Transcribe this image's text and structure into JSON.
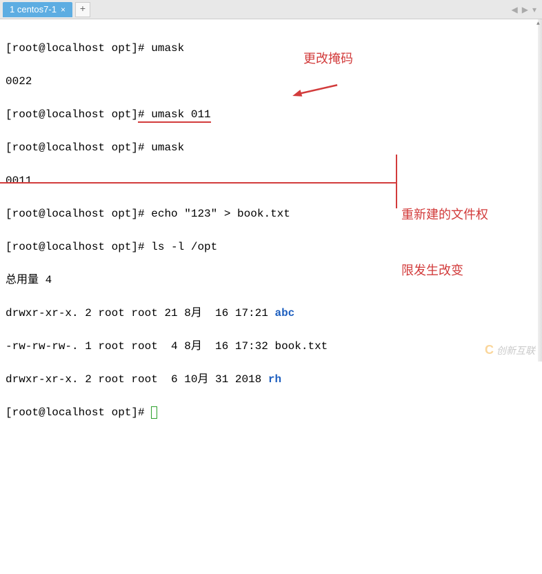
{
  "tab": {
    "label": "1 centos7-1",
    "close": "×"
  },
  "nav": {
    "left": "◀",
    "right": "▶",
    "menu": "▾"
  },
  "terminal": {
    "lines": [
      {
        "prompt": "[root@localhost opt]# ",
        "cmd": "umask"
      },
      {
        "text": "0022"
      },
      {
        "prompt": "[root@localhost opt]",
        "cmd_underlined": "# umask 011"
      },
      {
        "prompt": "[root@localhost opt]# ",
        "cmd": "umask"
      },
      {
        "text": "0011"
      },
      {
        "prompt": "[root@localhost opt]# ",
        "cmd": "echo \"123\" > book.txt"
      },
      {
        "prompt": "[root@localhost opt]# ",
        "cmd": "ls -l /opt"
      },
      {
        "text": "总用量 4"
      },
      {
        "text": "drwxr-xr-x. 2 root root 21 8月  16 17:21 ",
        "dir": "abc"
      },
      {
        "text": "-rw-rw-rw-. 1 root root  4 8月  16 17:32 book.txt"
      },
      {
        "text": "drwxr-xr-x. 2 root root  6 10月 31 2018 ",
        "dir": "rh"
      },
      {
        "prompt": "[root@localhost opt]# ",
        "cursor": true
      }
    ]
  },
  "annotations": {
    "ann1": "更改掩码",
    "ann2_line1": "重新建的文件权",
    "ann2_line2": "限发生改变"
  },
  "arrow": "←",
  "watermark": {
    "icon": "C",
    "text": "创新互联"
  }
}
